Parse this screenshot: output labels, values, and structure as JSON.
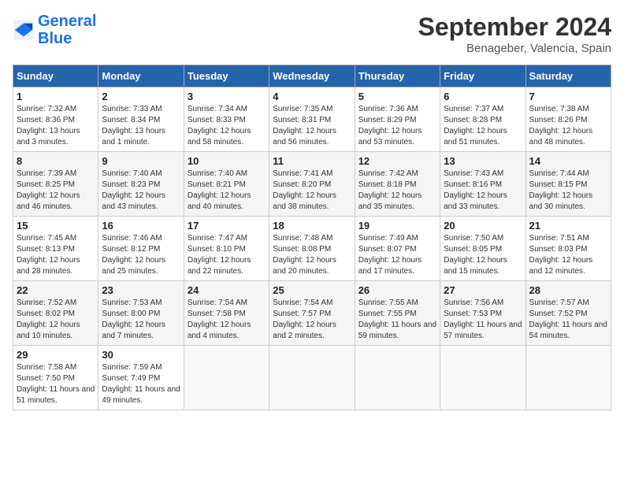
{
  "header": {
    "logo_line1": "General",
    "logo_line2": "Blue",
    "month": "September 2024",
    "location": "Benageber, Valencia, Spain"
  },
  "days_of_week": [
    "Sunday",
    "Monday",
    "Tuesday",
    "Wednesday",
    "Thursday",
    "Friday",
    "Saturday"
  ],
  "weeks": [
    [
      {
        "day": 1,
        "info": "Sunrise: 7:32 AM\nSunset: 8:36 PM\nDaylight: 13 hours and 3 minutes."
      },
      {
        "day": 2,
        "info": "Sunrise: 7:33 AM\nSunset: 8:34 PM\nDaylight: 13 hours and 1 minute."
      },
      {
        "day": 3,
        "info": "Sunrise: 7:34 AM\nSunset: 8:33 PM\nDaylight: 12 hours and 58 minutes."
      },
      {
        "day": 4,
        "info": "Sunrise: 7:35 AM\nSunset: 8:31 PM\nDaylight: 12 hours and 56 minutes."
      },
      {
        "day": 5,
        "info": "Sunrise: 7:36 AM\nSunset: 8:29 PM\nDaylight: 12 hours and 53 minutes."
      },
      {
        "day": 6,
        "info": "Sunrise: 7:37 AM\nSunset: 8:28 PM\nDaylight: 12 hours and 51 minutes."
      },
      {
        "day": 7,
        "info": "Sunrise: 7:38 AM\nSunset: 8:26 PM\nDaylight: 12 hours and 48 minutes."
      }
    ],
    [
      {
        "day": 8,
        "info": "Sunrise: 7:39 AM\nSunset: 8:25 PM\nDaylight: 12 hours and 46 minutes."
      },
      {
        "day": 9,
        "info": "Sunrise: 7:40 AM\nSunset: 8:23 PM\nDaylight: 12 hours and 43 minutes."
      },
      {
        "day": 10,
        "info": "Sunrise: 7:40 AM\nSunset: 8:21 PM\nDaylight: 12 hours and 40 minutes."
      },
      {
        "day": 11,
        "info": "Sunrise: 7:41 AM\nSunset: 8:20 PM\nDaylight: 12 hours and 38 minutes."
      },
      {
        "day": 12,
        "info": "Sunrise: 7:42 AM\nSunset: 8:18 PM\nDaylight: 12 hours and 35 minutes."
      },
      {
        "day": 13,
        "info": "Sunrise: 7:43 AM\nSunset: 8:16 PM\nDaylight: 12 hours and 33 minutes."
      },
      {
        "day": 14,
        "info": "Sunrise: 7:44 AM\nSunset: 8:15 PM\nDaylight: 12 hours and 30 minutes."
      }
    ],
    [
      {
        "day": 15,
        "info": "Sunrise: 7:45 AM\nSunset: 8:13 PM\nDaylight: 12 hours and 28 minutes."
      },
      {
        "day": 16,
        "info": "Sunrise: 7:46 AM\nSunset: 8:12 PM\nDaylight: 12 hours and 25 minutes."
      },
      {
        "day": 17,
        "info": "Sunrise: 7:47 AM\nSunset: 8:10 PM\nDaylight: 12 hours and 22 minutes."
      },
      {
        "day": 18,
        "info": "Sunrise: 7:48 AM\nSunset: 8:08 PM\nDaylight: 12 hours and 20 minutes."
      },
      {
        "day": 19,
        "info": "Sunrise: 7:49 AM\nSunset: 8:07 PM\nDaylight: 12 hours and 17 minutes."
      },
      {
        "day": 20,
        "info": "Sunrise: 7:50 AM\nSunset: 8:05 PM\nDaylight: 12 hours and 15 minutes."
      },
      {
        "day": 21,
        "info": "Sunrise: 7:51 AM\nSunset: 8:03 PM\nDaylight: 12 hours and 12 minutes."
      }
    ],
    [
      {
        "day": 22,
        "info": "Sunrise: 7:52 AM\nSunset: 8:02 PM\nDaylight: 12 hours and 10 minutes."
      },
      {
        "day": 23,
        "info": "Sunrise: 7:53 AM\nSunset: 8:00 PM\nDaylight: 12 hours and 7 minutes."
      },
      {
        "day": 24,
        "info": "Sunrise: 7:54 AM\nSunset: 7:58 PM\nDaylight: 12 hours and 4 minutes."
      },
      {
        "day": 25,
        "info": "Sunrise: 7:54 AM\nSunset: 7:57 PM\nDaylight: 12 hours and 2 minutes."
      },
      {
        "day": 26,
        "info": "Sunrise: 7:55 AM\nSunset: 7:55 PM\nDaylight: 11 hours and 59 minutes."
      },
      {
        "day": 27,
        "info": "Sunrise: 7:56 AM\nSunset: 7:53 PM\nDaylight: 11 hours and 57 minutes."
      },
      {
        "day": 28,
        "info": "Sunrise: 7:57 AM\nSunset: 7:52 PM\nDaylight: 11 hours and 54 minutes."
      }
    ],
    [
      {
        "day": 29,
        "info": "Sunrise: 7:58 AM\nSunset: 7:50 PM\nDaylight: 11 hours and 51 minutes."
      },
      {
        "day": 30,
        "info": "Sunrise: 7:59 AM\nSunset: 7:49 PM\nDaylight: 11 hours and 49 minutes."
      },
      null,
      null,
      null,
      null,
      null
    ]
  ]
}
